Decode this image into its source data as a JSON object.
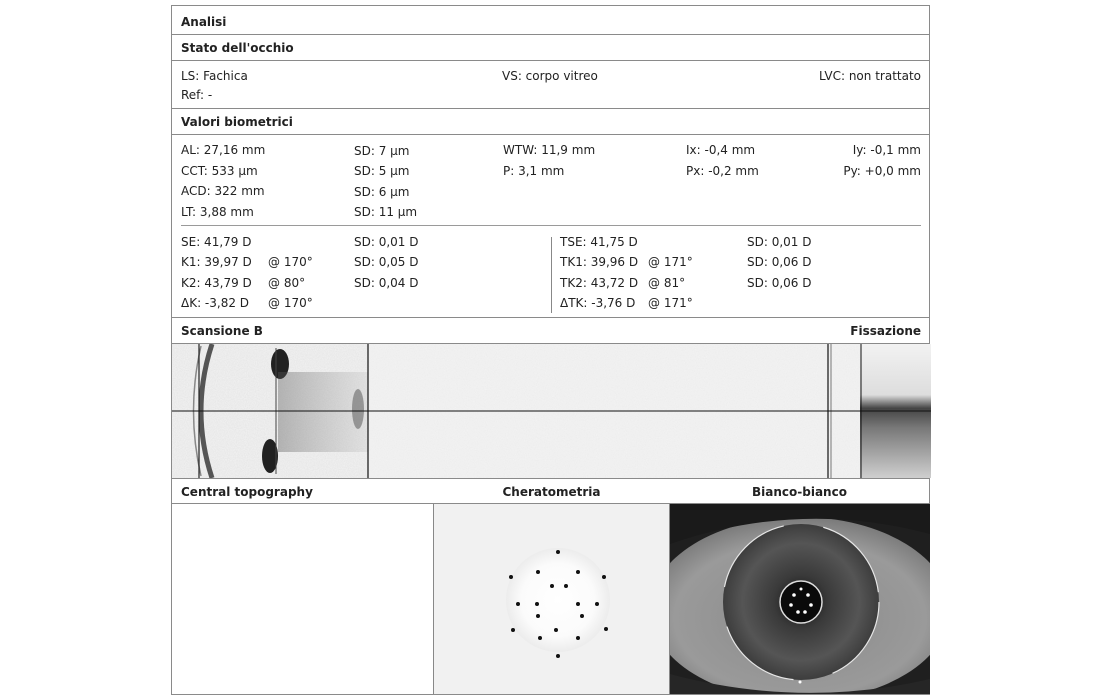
{
  "sections": {
    "analisi": "Analisi",
    "stato": "Stato dell'occhio",
    "valori": "Valori biometrici",
    "scansione": "Scansione B",
    "fissazione": "Fissazione",
    "topography": "Central topography",
    "cheratometria": "Cheratometria",
    "bianco": "Bianco-bianco"
  },
  "eye_state": {
    "ls": "LS: Fachica",
    "ref": "Ref: -",
    "vs": "VS: corpo vitreo",
    "lvc": "LVC: non trattato"
  },
  "biometry": {
    "al": "AL: 27,16 mm",
    "cct": "CCT: 533 µm",
    "acd": "ACD: 322 mm",
    "lt": "LT: 3,88 mm",
    "sd_al": "SD: 7 µm",
    "sd_cct": "SD: 5 µm",
    "sd_acd": "SD: 6 µm",
    "sd_lt": "SD: 11 µm",
    "wtw": "WTW: 11,9 mm",
    "p": "P: 3,1 mm",
    "ix": "Ix: -0,4 mm",
    "px": "Px: -0,2 mm",
    "iy": "Iy: -0,1 mm",
    "py": "Py: +0,0 mm"
  },
  "keratometry_left": {
    "se": "SE: 41,79 D",
    "k1": "K1: 39,97 D",
    "k2": "K2: 43,79 D",
    "dk": "ΔK: -3,82 D",
    "k1_axis": "@ 170°",
    "k2_axis": "@ 80°",
    "dk_axis": "@ 170°",
    "sd_se": "SD: 0,01 D",
    "sd_k1": "SD: 0,05 D",
    "sd_k2": "SD: 0,04 D"
  },
  "keratometry_right": {
    "tse": "TSE: 41,75 D",
    "tk1": "TK1: 39,96 D",
    "tk2": "TK2: 43,72 D",
    "dtk": "ΔTK: -3,76 D",
    "tk1_axis": "@ 171°",
    "tk2_axis": "@ 81°",
    "dtk_axis": "@ 171°",
    "sd_tse": "SD: 0,01 D",
    "sd_tk1": "SD: 0,06 D",
    "sd_tk2": "SD: 0,06 D"
  },
  "icons": [
    "bscan-image",
    "fixation-image",
    "keratometry-rings-image",
    "white-to-white-eye-image"
  ],
  "colors": {
    "border": "#8a8a8a",
    "text": "#222222"
  }
}
